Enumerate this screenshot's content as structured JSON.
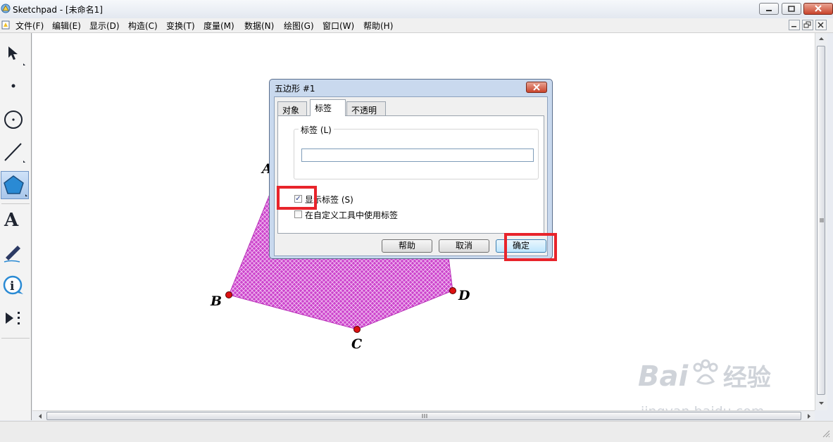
{
  "window": {
    "title": "Sketchpad  - [未命名1]"
  },
  "menu": [
    {
      "label": "文件(F)"
    },
    {
      "label": "编辑(E)"
    },
    {
      "label": "显示(D)"
    },
    {
      "label": "构造(C)"
    },
    {
      "label": "变换(T)"
    },
    {
      "label": "度量(M)"
    },
    {
      "label": "数据(N)"
    },
    {
      "label": "绘图(G)"
    },
    {
      "label": "窗口(W)"
    },
    {
      "label": "帮助(H)"
    }
  ],
  "toolbox": [
    {
      "name": "arrow-select-tool"
    },
    {
      "name": "point-tool"
    },
    {
      "name": "compass-tool"
    },
    {
      "name": "straightedge-tool"
    },
    {
      "name": "polygon-tool",
      "active": true
    },
    {
      "name": "text-tool",
      "glyph": "A"
    },
    {
      "name": "marker-tool"
    },
    {
      "name": "information-tool"
    },
    {
      "name": "custom-tool"
    }
  ],
  "figure": {
    "fill_color": "#cc44cc",
    "vertex_color": "#dd1111",
    "labels": {
      "A": "A",
      "B": "B",
      "C": "C",
      "D": "D"
    }
  },
  "dialog": {
    "title": "五边形 #1",
    "tabs": [
      {
        "label": "对象",
        "active": false
      },
      {
        "label": "标签",
        "active": true
      },
      {
        "label": "不透明度",
        "active": false
      }
    ],
    "label_group": "标签 (L)",
    "label_value": "",
    "show_label": {
      "label": "显示标签 (S)",
      "checked": true,
      "mark": "✓"
    },
    "use_in_custom": {
      "label": "在自定义工具中使用标签",
      "checked": false
    },
    "buttons": {
      "help": "帮助",
      "cancel": "取消",
      "ok": "确定"
    }
  },
  "watermark": {
    "brand": "Bai",
    "suffix": "经验",
    "url": "jingyan.baidu.com"
  },
  "colors": {
    "highlight": "#e8242b",
    "polygon": "#cc44cc"
  }
}
